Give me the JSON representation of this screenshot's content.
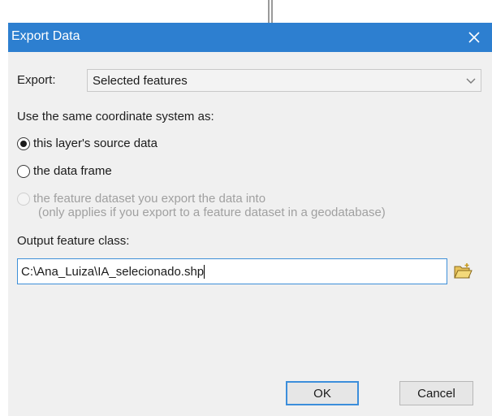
{
  "dialog": {
    "title": "Export Data",
    "close_icon": "close-icon"
  },
  "export": {
    "label": "Export:",
    "selected": "Selected features"
  },
  "coordinate": {
    "heading": "Use the same coordinate system as:",
    "options": [
      {
        "label": "this layer's source data",
        "selected": true,
        "enabled": true
      },
      {
        "label": "the data frame",
        "selected": false,
        "enabled": true
      },
      {
        "label": "the feature dataset you export the data into",
        "sublabel": "(only applies if you export to a feature dataset in a geodatabase)",
        "selected": false,
        "enabled": false
      }
    ]
  },
  "output": {
    "label": "Output feature class:",
    "value": "C:\\Ana_Luiza\\IA_selecionado.shp",
    "browse_icon": "folder-open-icon"
  },
  "buttons": {
    "ok": "OK",
    "cancel": "Cancel"
  },
  "colors": {
    "titlebar": "#2d7fd0",
    "dialog_bg": "#f0f0f0",
    "focus_border": "#3c8edb",
    "disabled_text": "#a0a0a0"
  }
}
